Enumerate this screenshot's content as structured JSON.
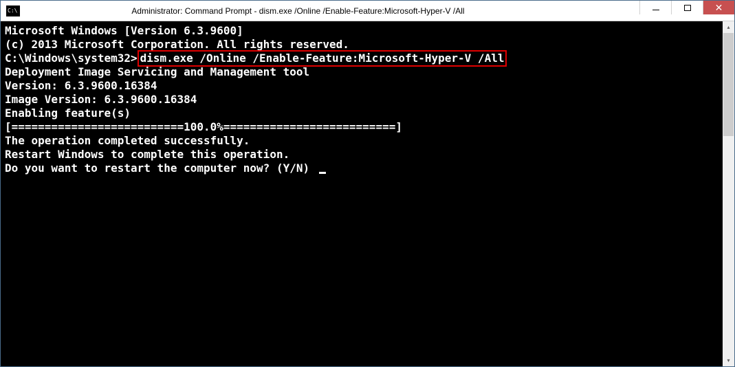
{
  "window": {
    "icon_text": "C:\\",
    "title": "Administrator: Command Prompt - dism.exe  /Online /Enable-Feature:Microsoft-Hyper-V /All"
  },
  "terminal": {
    "line1": "Microsoft Windows [Version 6.3.9600]",
    "line2": "(c) 2013 Microsoft Corporation. All rights reserved.",
    "blank1": "",
    "prompt": "C:\\Windows\\system32>",
    "command": "dism.exe /Online /Enable-Feature:Microsoft-Hyper-V /All",
    "blank2": "",
    "line3": "Deployment Image Servicing and Management tool",
    "line4": "Version: 6.3.9600.16384",
    "blank3": "",
    "line5": "Image Version: 6.3.9600.16384",
    "blank4": "",
    "line6": "Enabling feature(s)",
    "line7": "[==========================100.0%==========================]",
    "line8": "The operation completed successfully.",
    "line9": "Restart Windows to complete this operation.",
    "line10": "Do you want to restart the computer now? (Y/N) "
  }
}
